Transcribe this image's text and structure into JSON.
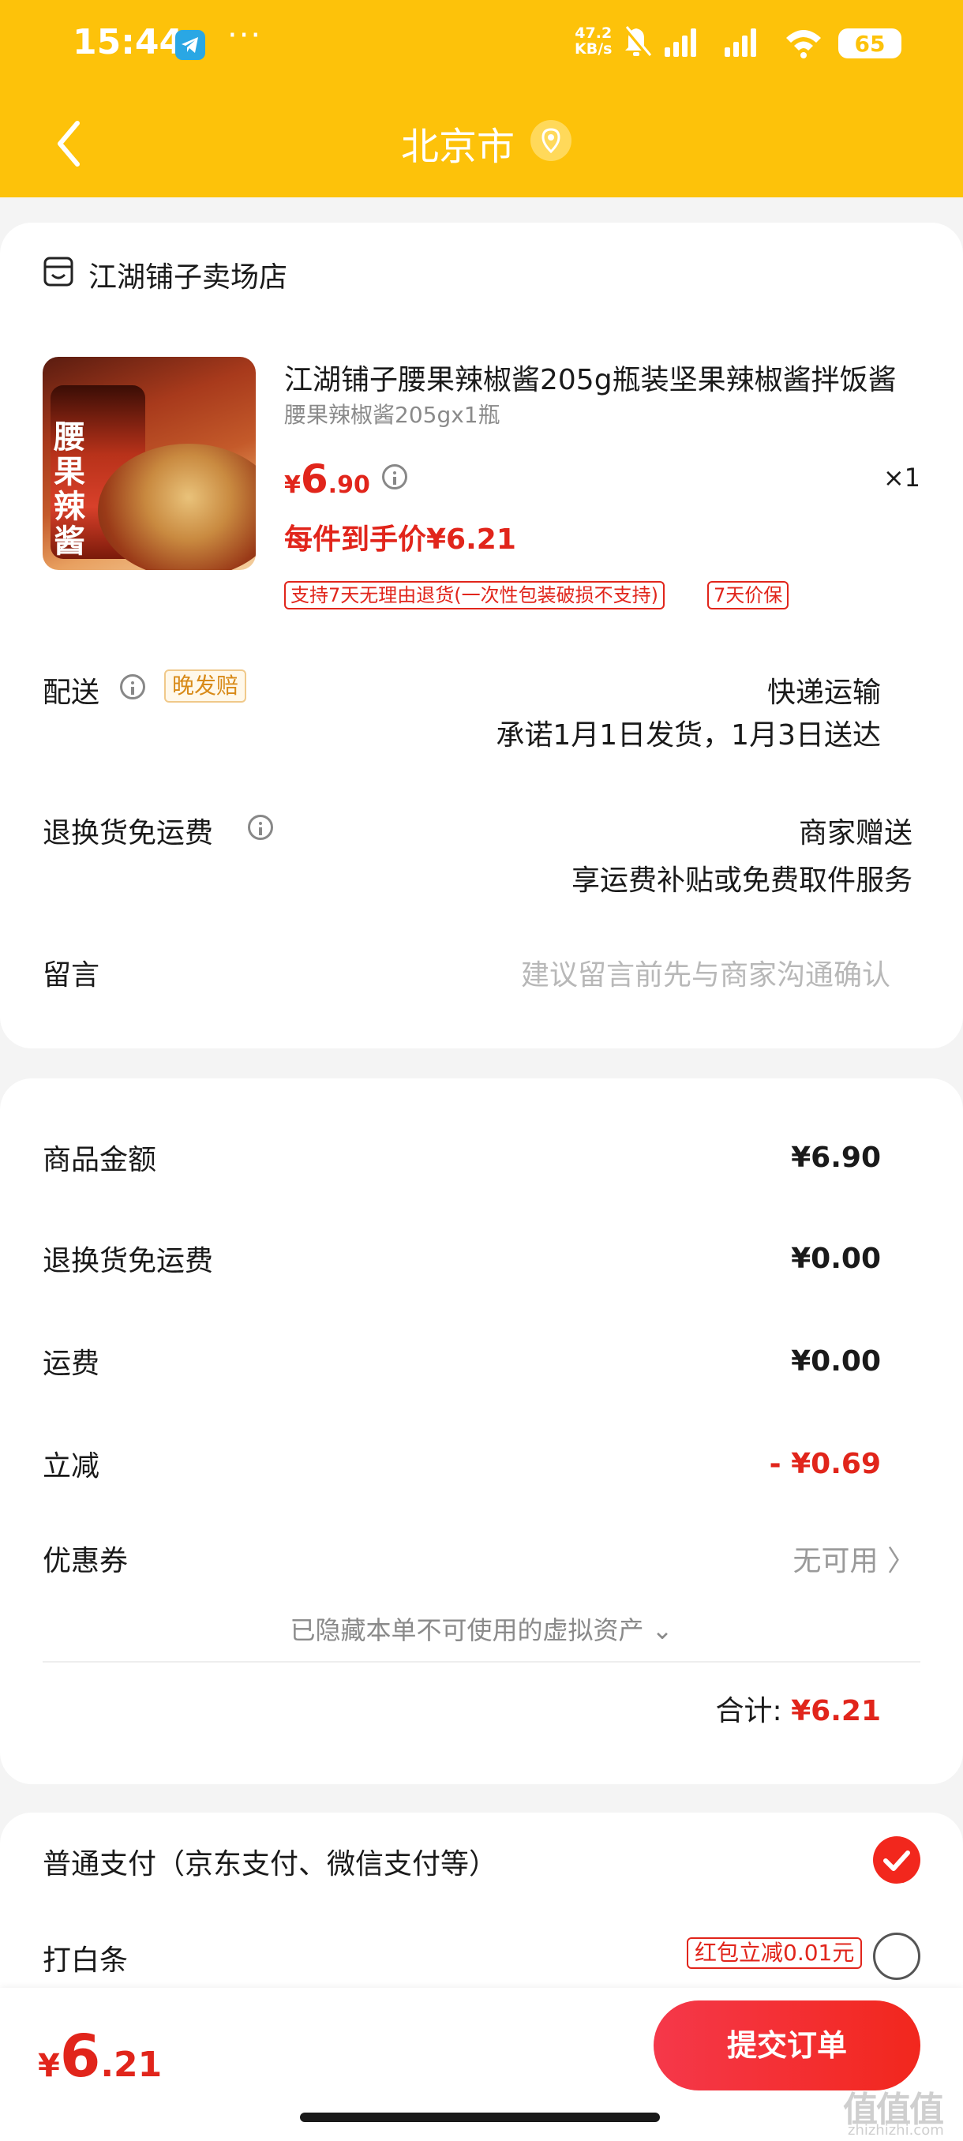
{
  "status_bar": {
    "time": "15:44",
    "dots": "···",
    "speed_value": "47.2",
    "speed_unit": "KB/s",
    "battery": "65"
  },
  "nav": {
    "title": "北京市",
    "back_icon": "chevron-left-icon",
    "location_icon": "location-pin-icon"
  },
  "shop": {
    "name": "江湖铺子卖场店",
    "icon": "store-icon"
  },
  "product": {
    "title": "江湖铺子腰果辣椒酱205g瓶装坚果辣椒酱拌饭酱",
    "spec": "腰果辣椒酱205gx1瓶",
    "price_yen": "¥",
    "price_int": "6",
    "price_dec": ".90",
    "qty": "×1",
    "per_price": "每件到手价¥6.21",
    "image_label": "腰果辣酱",
    "tags": [
      "支持7天无理由退货(一次性包装破损不支持)",
      "7天价保"
    ]
  },
  "delivery": {
    "label": "配送",
    "badge": "晚发赔",
    "method": "快递运输",
    "promise": "承诺1月1日发货，1月3日送达"
  },
  "return_shipping": {
    "label": "退换货免运费",
    "value": "商家赠送",
    "desc": "享运费补贴或免费取件服务"
  },
  "message": {
    "label": "留言",
    "placeholder": "建议留言前先与商家沟通确认"
  },
  "summary": {
    "rows": [
      {
        "label": "商品金额",
        "value": "¥6.90"
      },
      {
        "label": "退换货免运费",
        "value": "¥0.00"
      },
      {
        "label": "运费",
        "value": "¥0.00"
      },
      {
        "label": "立减",
        "value": "- ¥0.69"
      }
    ],
    "coupon_label": "优惠券",
    "coupon_value": "无可用 〉",
    "hidden_assets": "已隐藏本单不可使用的虚拟资产 ⌄",
    "total_label": "合计:",
    "total_value": "¥6.21"
  },
  "payment": {
    "normal": "普通支付（京东支付、微信支付等）",
    "baitiao": "打白条",
    "baitiao_promo": "红包立减0.01元"
  },
  "bottom": {
    "price_yen": "¥",
    "price_int": "6",
    "price_dec": ".21",
    "submit": "提交订单",
    "watermark": "值值值",
    "watermark_sub": "zhizhizhi.com"
  },
  "colors": {
    "brand_yellow": "#fdc20a",
    "price_red": "#e1251b",
    "button_red": "#f2271d"
  }
}
